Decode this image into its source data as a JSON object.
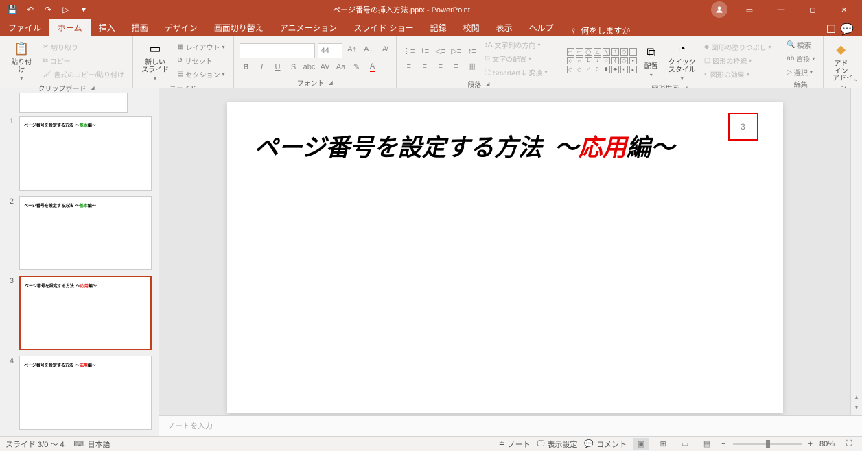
{
  "titlebar": {
    "doc_title": "ページ番号の挿入方法.pptx - PowerPoint",
    "qat": {
      "save": "💾",
      "undo": "↶",
      "redo": "↷",
      "start": "▷"
    }
  },
  "tabs": {
    "file": "ファイル",
    "home": "ホーム",
    "insert": "挿入",
    "draw": "描画",
    "design": "デザイン",
    "transitions": "画面切り替え",
    "animations": "アニメーション",
    "slideshow": "スライド ショー",
    "record": "記録",
    "review": "校閲",
    "view": "表示",
    "help": "ヘルプ",
    "tellme": "何をしますか"
  },
  "ribbon": {
    "clipboard": {
      "label": "クリップボード",
      "paste": "貼り付け",
      "cut": "切り取り",
      "copy": "コピー",
      "format_painter": "書式のコピー/貼り付け"
    },
    "slides": {
      "label": "スライド",
      "new_slide": "新しい\nスライド",
      "layout": "レイアウト",
      "reset": "リセット",
      "section": "セクション"
    },
    "font": {
      "label": "フォント",
      "size": "44"
    },
    "paragraph": {
      "label": "段落",
      "text_direction": "文字列の方向",
      "align_text": "文字の配置",
      "convert_smartart": "SmartArt に変換"
    },
    "drawing": {
      "label": "図形描画",
      "arrange": "配置",
      "quick_styles": "クイック\nスタイル",
      "shape_fill": "図形の塗りつぶし",
      "shape_outline": "図形の枠線",
      "shape_effects": "図形の効果"
    },
    "editing": {
      "label": "編集",
      "find": "検索",
      "replace": "置換",
      "select": "選択"
    },
    "addins": {
      "label": "アドイン",
      "addin": "アド\nイン"
    }
  },
  "thumbnails": [
    {
      "num": "1",
      "title_a": "ページ番号を設定する方法",
      "tilde1": "～",
      "accent": "基本",
      "title_b": "編～",
      "accent_class": "green",
      "selected": false
    },
    {
      "num": "2",
      "title_a": "ページ番号を設定する方法",
      "tilde1": "～",
      "accent": "基本",
      "title_b": "編～",
      "accent_class": "green",
      "selected": false
    },
    {
      "num": "3",
      "title_a": "ページ番号を設定する方法",
      "tilde1": "～",
      "accent": "応用",
      "title_b": "編～",
      "accent_class": "red",
      "selected": true
    },
    {
      "num": "4",
      "title_a": "ページ番号を設定する方法",
      "tilde1": "～",
      "accent": "応用",
      "title_b": "編～",
      "accent_class": "red",
      "selected": false
    }
  ],
  "slide": {
    "title_a": "ページ番号を設定する方法",
    "tilde1": "～",
    "accent": "応用",
    "title_b": "編～",
    "page_number": "3"
  },
  "notes": {
    "placeholder": "ノートを入力"
  },
  "statusbar": {
    "slide_info": "スライド 3/0 ～ 4",
    "language": "日本語",
    "notes_btn": "ノート",
    "display_settings": "表示設定",
    "comments": "コメント",
    "zoom_minus": "−",
    "zoom_plus": "+",
    "zoom_value": "80%"
  }
}
